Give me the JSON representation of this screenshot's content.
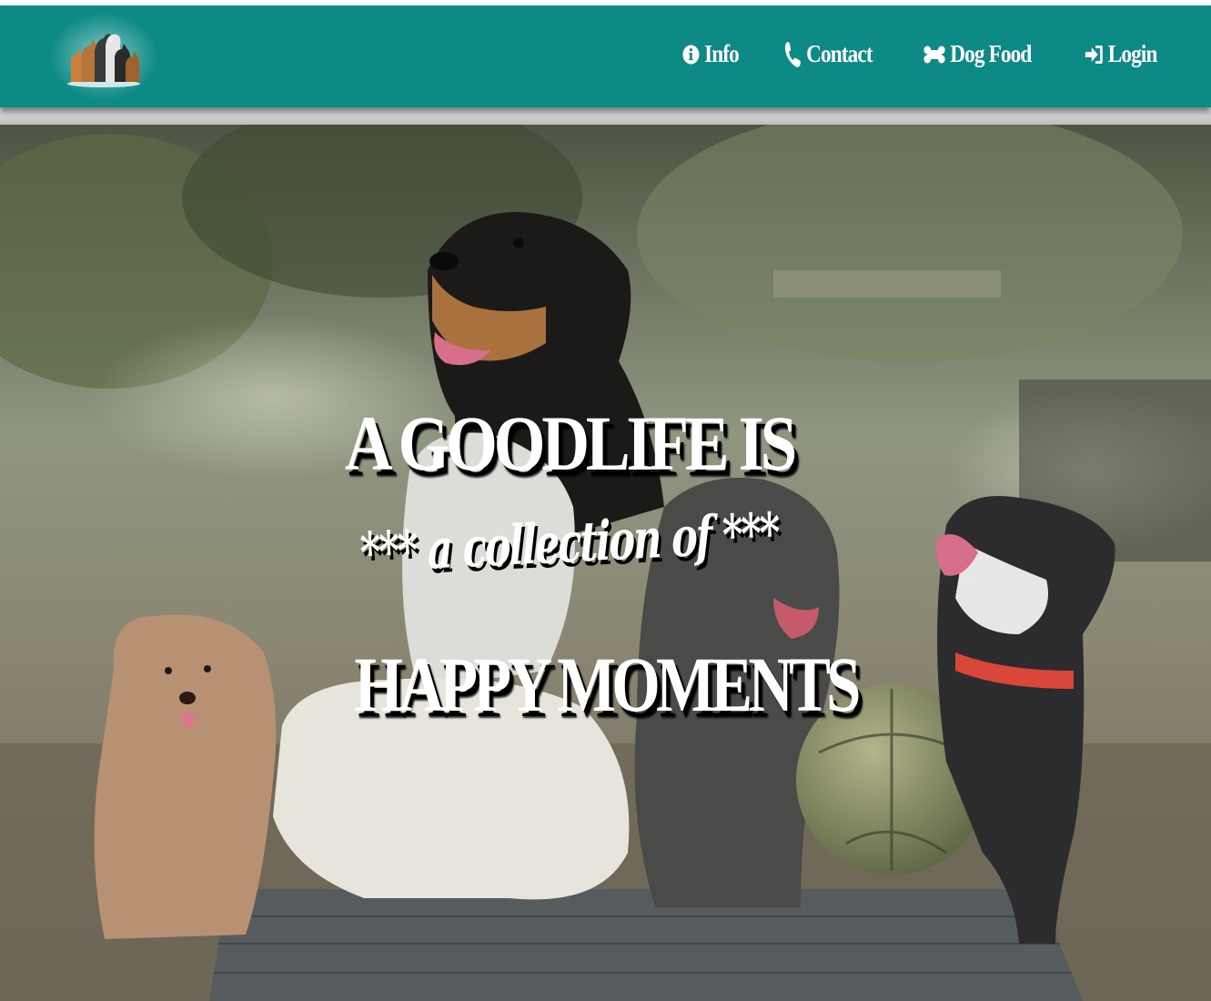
{
  "nav": {
    "logo_icon": "dogs-group-logo",
    "links": [
      {
        "label": "Info",
        "icon": "info-circle-icon"
      },
      {
        "label": "Contact",
        "icon": "phone-icon"
      },
      {
        "label": "Dog Food",
        "icon": "bone-icon"
      },
      {
        "label": "Login",
        "icon": "sign-in-icon"
      }
    ]
  },
  "hero": {
    "line1": "A GOODLIFE IS",
    "line2": "*** a collection of ***",
    "line3": "HAPPY MOMENTS"
  },
  "colors": {
    "navbar": "#0e8a86",
    "nav_text": "#ffffff",
    "headline_text": "#ffffff",
    "headline_shadow": "#000000"
  }
}
